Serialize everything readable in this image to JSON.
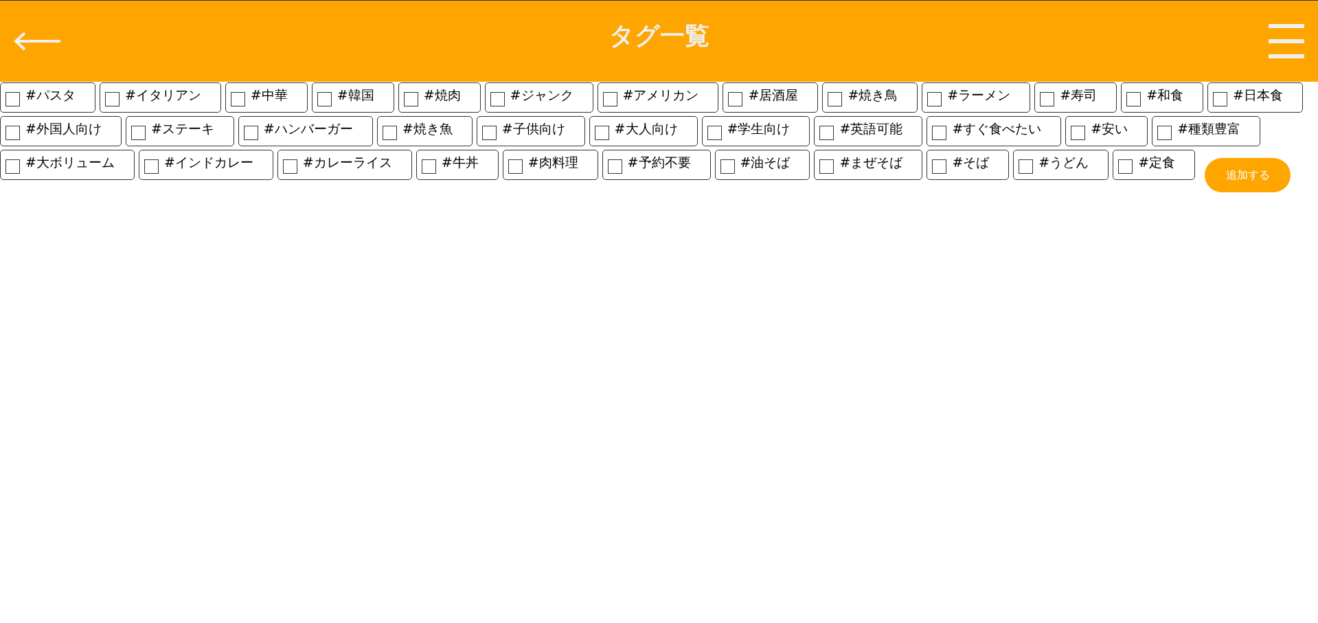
{
  "header": {
    "title": "タグ一覧"
  },
  "tags": [
    {
      "label": "#パスタ",
      "checked": false
    },
    {
      "label": "#イタリアン",
      "checked": false
    },
    {
      "label": "#中華",
      "checked": false
    },
    {
      "label": "#韓国",
      "checked": false
    },
    {
      "label": "#焼肉",
      "checked": false
    },
    {
      "label": "#ジャンク",
      "checked": false
    },
    {
      "label": "#アメリカン",
      "checked": false
    },
    {
      "label": "#居酒屋",
      "checked": false
    },
    {
      "label": "#焼き鳥",
      "checked": false
    },
    {
      "label": "#ラーメン",
      "checked": false
    },
    {
      "label": "#寿司",
      "checked": false
    },
    {
      "label": "#和食",
      "checked": false
    },
    {
      "label": "#日本食",
      "checked": false
    },
    {
      "label": "#外国人向け",
      "checked": false
    },
    {
      "label": "#ステーキ",
      "checked": false
    },
    {
      "label": "#ハンバーガー",
      "checked": false
    },
    {
      "label": "#焼き魚",
      "checked": false
    },
    {
      "label": "#子供向け",
      "checked": false
    },
    {
      "label": "#大人向け",
      "checked": false
    },
    {
      "label": "#学生向け",
      "checked": false
    },
    {
      "label": "#英語可能",
      "checked": false
    },
    {
      "label": "#すぐ食べたい",
      "checked": false
    },
    {
      "label": "#安い",
      "checked": false
    },
    {
      "label": "#種類豊富",
      "checked": false
    },
    {
      "label": "#大ボリューム",
      "checked": false
    },
    {
      "label": "#インドカレー",
      "checked": false
    },
    {
      "label": "#カレーライス",
      "checked": false
    },
    {
      "label": "#牛丼",
      "checked": false
    },
    {
      "label": "#肉料理",
      "checked": false
    },
    {
      "label": "#予約不要",
      "checked": false
    },
    {
      "label": "#油そば",
      "checked": false
    },
    {
      "label": "#まぜそば",
      "checked": false
    },
    {
      "label": "#そば",
      "checked": false
    },
    {
      "label": "#うどん",
      "checked": false
    },
    {
      "label": "#定食",
      "checked": false
    }
  ],
  "add_button": {
    "label": "追加する"
  }
}
